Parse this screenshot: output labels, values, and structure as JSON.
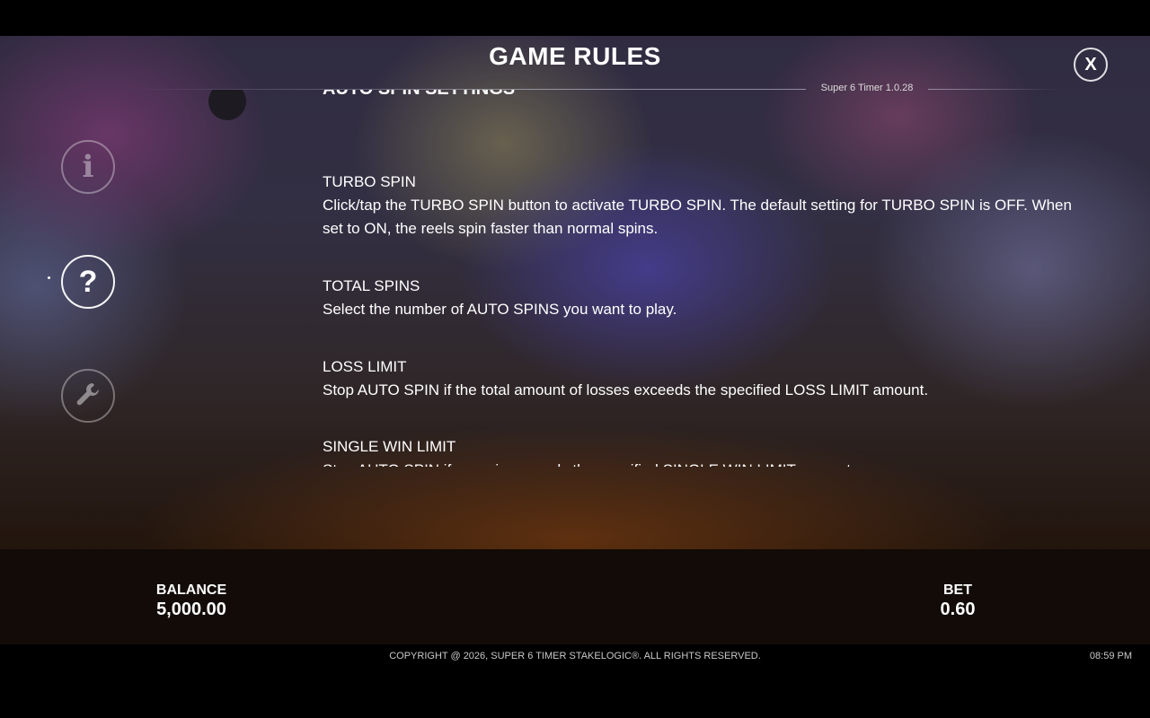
{
  "header": {
    "title": "GAME RULES",
    "version": "Super 6 Timer 1.0.28",
    "close_label": "X"
  },
  "nav": {
    "info_symbol": "i",
    "help_symbol": "?",
    "settings_icon": "wrench-icon"
  },
  "content": {
    "section_heading": "AUTO SPIN SETTINGS",
    "rules": [
      {
        "title": "TURBO SPIN",
        "text": "Click/tap the TURBO SPIN button to activate TURBO SPIN. The default setting for TURBO SPIN is OFF. When set to ON, the reels spin faster than normal spins."
      },
      {
        "title": "TOTAL SPINS",
        "text": "Select the number of AUTO SPINS you want to play."
      },
      {
        "title": "LOSS LIMIT",
        "text": "Stop AUTO SPIN if the total amount of losses exceeds the specified LOSS LIMIT amount."
      },
      {
        "title": "SINGLE WIN LIMIT",
        "text": "Stop AUTO SPIN if any win exceeds the specified SINGLE WIN LIMIT amount."
      }
    ]
  },
  "status": {
    "balance_label": "BALANCE",
    "balance_value": "5,000.00",
    "bet_label": "BET",
    "bet_value": "0.60"
  },
  "footer": {
    "copyright": "COPYRIGHT @ 2026, SUPER 6 TIMER STAKELOGIC®. ALL RIGHTS RESERVED.",
    "time": "08:59 PM"
  }
}
